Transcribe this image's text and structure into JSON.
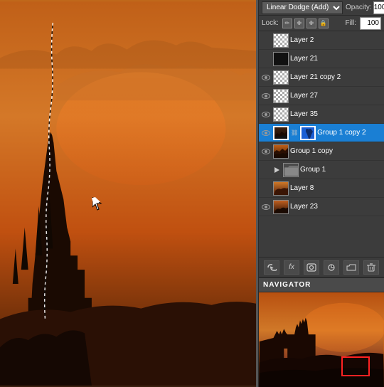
{
  "blend_toolbar": {
    "blend_mode": "Linear Dodge (Add)",
    "opacity_label": "Opacity:",
    "opacity_value": "100",
    "fill_label": "Fill:",
    "fill_value": "100"
  },
  "lock_row": {
    "label": "Lock:",
    "icons": [
      "✏",
      "✙",
      "🔒"
    ]
  },
  "layers": [
    {
      "id": 1,
      "name": "Layer 2",
      "visible": false,
      "active": false,
      "thumb": "checkerboard",
      "indent": 0
    },
    {
      "id": 2,
      "name": "Layer 21",
      "visible": false,
      "active": false,
      "thumb": "black",
      "indent": 0
    },
    {
      "id": 3,
      "name": "Layer 21 copy 2",
      "visible": true,
      "active": false,
      "thumb": "checkerboard",
      "indent": 0
    },
    {
      "id": 4,
      "name": "Layer 27",
      "visible": true,
      "active": false,
      "thumb": "checkerboard",
      "indent": 0
    },
    {
      "id": 5,
      "name": "Layer 35",
      "visible": true,
      "active": false,
      "thumb": "checkerboard",
      "indent": 0
    },
    {
      "id": 6,
      "name": "Group 1 copy 2",
      "visible": true,
      "active": true,
      "thumb": "castle_dark",
      "hasMask": true,
      "indent": 0
    },
    {
      "id": 7,
      "name": "Group 1 copy",
      "visible": true,
      "active": false,
      "thumb": "castle_orange",
      "indent": 0
    },
    {
      "id": 8,
      "name": "Group 1",
      "visible": false,
      "active": false,
      "thumb": "folder",
      "indent": 0,
      "isGroup": true
    },
    {
      "id": 9,
      "name": "Layer 8",
      "visible": false,
      "active": false,
      "thumb": "castle_orange2",
      "indent": 0
    },
    {
      "id": 10,
      "name": "Layer 23",
      "visible": true,
      "active": false,
      "thumb": "castle_dark2",
      "indent": 0
    }
  ],
  "toolbar_buttons": [
    {
      "icon": "⛓",
      "name": "link-button"
    },
    {
      "icon": "fx",
      "name": "fx-button"
    },
    {
      "icon": "◻",
      "name": "mask-button"
    },
    {
      "icon": "☰",
      "name": "adjustment-button"
    },
    {
      "icon": "📁",
      "name": "group-button"
    },
    {
      "icon": "🗑",
      "name": "delete-button"
    }
  ],
  "navigator": {
    "title": "NAVIGATOR"
  }
}
